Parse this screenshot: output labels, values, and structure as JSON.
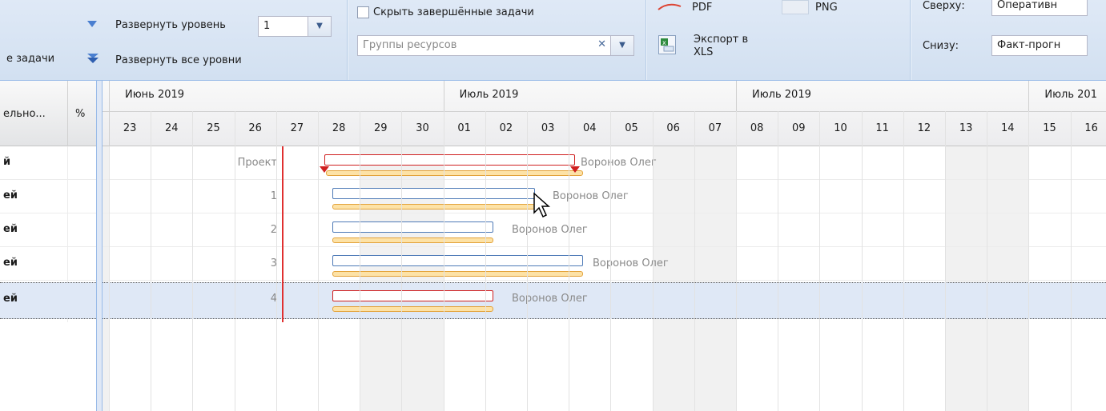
{
  "toolbar": {
    "expand_level_label": "Развернуть уровень",
    "expand_level_value": "1",
    "expand_all_label": "Развернуть все уровни",
    "tasks_label_partial": "е задачи",
    "hide_completed_label": "Скрыть завершённые задачи",
    "resource_groups_placeholder": "Группы ресурсов",
    "export_pdf": "PDF",
    "export_png": "PNG",
    "export_xls_line1": "Экспорт в",
    "export_xls_line2": "XLS",
    "top_label": "Сверху:",
    "top_value": "Оперативн",
    "bottom_label": "Снизу:",
    "bottom_value": "Факт-прогн"
  },
  "grid": {
    "col_name": "ельно...",
    "col_pct": "%",
    "rows": [
      {
        "name": "й",
        "task": "Проект"
      },
      {
        "name": "ей",
        "task": "1"
      },
      {
        "name": "ей",
        "task": "2"
      },
      {
        "name": "ей",
        "task": "3"
      },
      {
        "name": "ей",
        "task": "4"
      }
    ]
  },
  "timeline": {
    "months": [
      {
        "label": "Июнь 2019"
      },
      {
        "label": "Июль 2019"
      },
      {
        "label": "Июль 2019"
      },
      {
        "label": "Июль 201"
      }
    ],
    "days": [
      "23",
      "24",
      "25",
      "26",
      "27",
      "28",
      "29",
      "30",
      "01",
      "02",
      "03",
      "04",
      "05",
      "06",
      "07",
      "08",
      "09",
      "10",
      "11",
      "12",
      "13",
      "14",
      "15",
      "16"
    ],
    "weekend_days": [
      "29",
      "30",
      "06",
      "07",
      "13",
      "14"
    ]
  },
  "resource_name": "Воронов Олег",
  "colors": {
    "accent_blue": "#4e7ab7",
    "critical_red": "#d02020",
    "baseline_orange": "#e3a23a",
    "today_line": "#e03030",
    "selected_row": "#dfe8f6"
  }
}
